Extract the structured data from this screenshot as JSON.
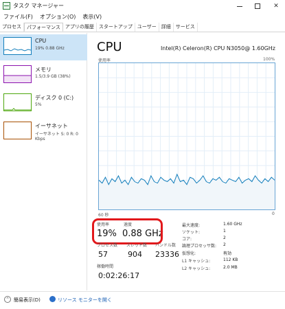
{
  "window": {
    "title": "タスク マネージャー"
  },
  "menu": [
    "ファイル(F)",
    "オプション(O)",
    "表示(V)"
  ],
  "tabs": [
    "プロセス",
    "パフォーマンス",
    "アプリの履歴",
    "スタートアップ",
    "ユーザー",
    "詳細",
    "サービス"
  ],
  "sidebar": {
    "items": [
      {
        "title": "CPU",
        "sub": "19% 0.88 GHz",
        "color": "#117dbb"
      },
      {
        "title": "メモリ",
        "sub": "1.5/3.9 GB (38%)",
        "color": "#8b12ae"
      },
      {
        "title": "ディスク 0 (C:)",
        "sub": "5%",
        "color": "#4da60c"
      },
      {
        "title": "イーサネット",
        "sub": "イーサネット S: 0 R: 0 Kbps",
        "color": "#a74f01"
      }
    ]
  },
  "main": {
    "title": "CPU",
    "model": "Intel(R) Celeron(R) CPU N3050@ 1.60GHz",
    "graph_label_left": "使用率",
    "graph_label_right": "100%",
    "axis_left": "60 秒",
    "axis_right": "0",
    "graph_color": "#117dbb"
  },
  "stats": {
    "usage_label": "使用率",
    "usage_value": "19%",
    "speed_label": "速度",
    "speed_value": "0.88 GHz",
    "process_label": "プロセス数",
    "process_value": "57",
    "thread_label": "スレッド数",
    "thread_value": "904",
    "handle_label": "ハンドル数",
    "handle_value": "23336",
    "uptime_label": "稼働時間",
    "uptime_value": "0:02:26:17"
  },
  "specs": [
    {
      "label": "最大速度:",
      "value": "1.60 GHz"
    },
    {
      "label": "ソケット:",
      "value": "1"
    },
    {
      "label": "コア:",
      "value": "2"
    },
    {
      "label": "論理プロセッサ数:",
      "value": "2"
    },
    {
      "label": "仮想化:",
      "value": "有効"
    },
    {
      "label": "L1 キャッシュ:",
      "value": "112 KB"
    },
    {
      "label": "L2 キャッシュ:",
      "value": "2.0 MB"
    }
  ],
  "footer": {
    "fewer_details": "簡易表示(D)",
    "resource_monitor": "リソース モニターを開く"
  },
  "chart_data": {
    "type": "area",
    "ylim": [
      0,
      100
    ],
    "values": [
      20,
      18,
      22,
      17,
      21,
      19,
      23,
      18,
      20,
      17,
      22,
      19,
      18,
      21,
      20,
      17,
      23,
      19,
      18,
      22,
      20,
      19,
      21,
      18,
      24,
      19,
      20,
      17,
      22,
      21,
      18,
      20,
      23,
      19,
      18,
      21,
      20,
      22,
      19,
      18,
      21,
      20,
      19,
      22,
      18,
      20,
      21,
      19,
      23,
      20,
      18,
      21,
      19,
      22,
      20
    ]
  }
}
